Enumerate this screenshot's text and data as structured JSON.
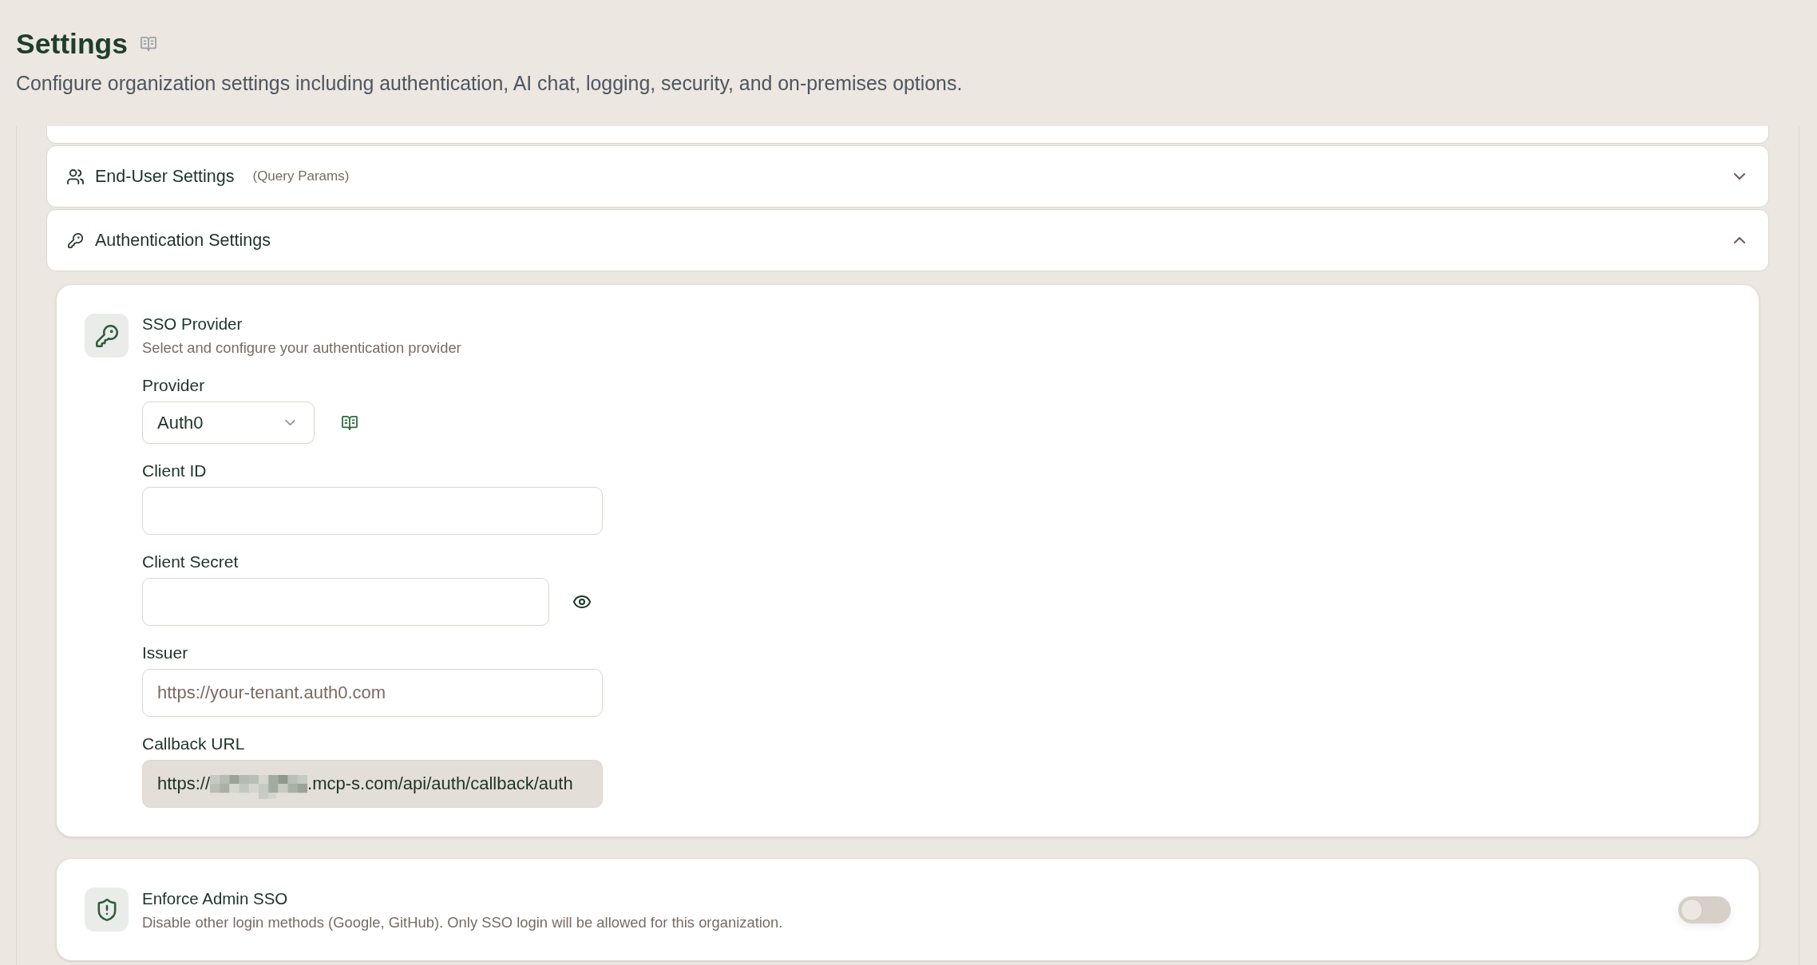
{
  "page": {
    "title": "Settings",
    "subtitle": "Configure organization settings including authentication, AI chat, logging, security, and on-premises options."
  },
  "sections": [
    {
      "title": "End-User Settings",
      "note": "(Query Params)",
      "expanded": false
    },
    {
      "title": "Authentication Settings",
      "expanded": true,
      "panels": [
        {
          "kind": "form",
          "title": "SSO Provider",
          "description": "Select and configure your authentication provider",
          "fields": [
            {
              "kind": "select",
              "label": "Provider",
              "value": "Auth0"
            },
            {
              "kind": "text",
              "label": "Client ID"
            },
            {
              "kind": "secret",
              "label": "Client Secret"
            },
            {
              "kind": "text",
              "label": "Issuer",
              "placeholder": "https://your-tenant.auth0.com"
            },
            {
              "kind": "readonly",
              "label": "Callback URL",
              "value_start": "https://",
              "redacted": true,
              "value_end": ".mcp-s.com/api/auth/callback/auth"
            }
          ]
        },
        {
          "kind": "toggle",
          "title": "Enforce Admin SSO",
          "description": "Disable other login methods (Google, GitHub). Only SSO login will be allowed for this organization.",
          "on": false
        }
      ]
    }
  ]
}
